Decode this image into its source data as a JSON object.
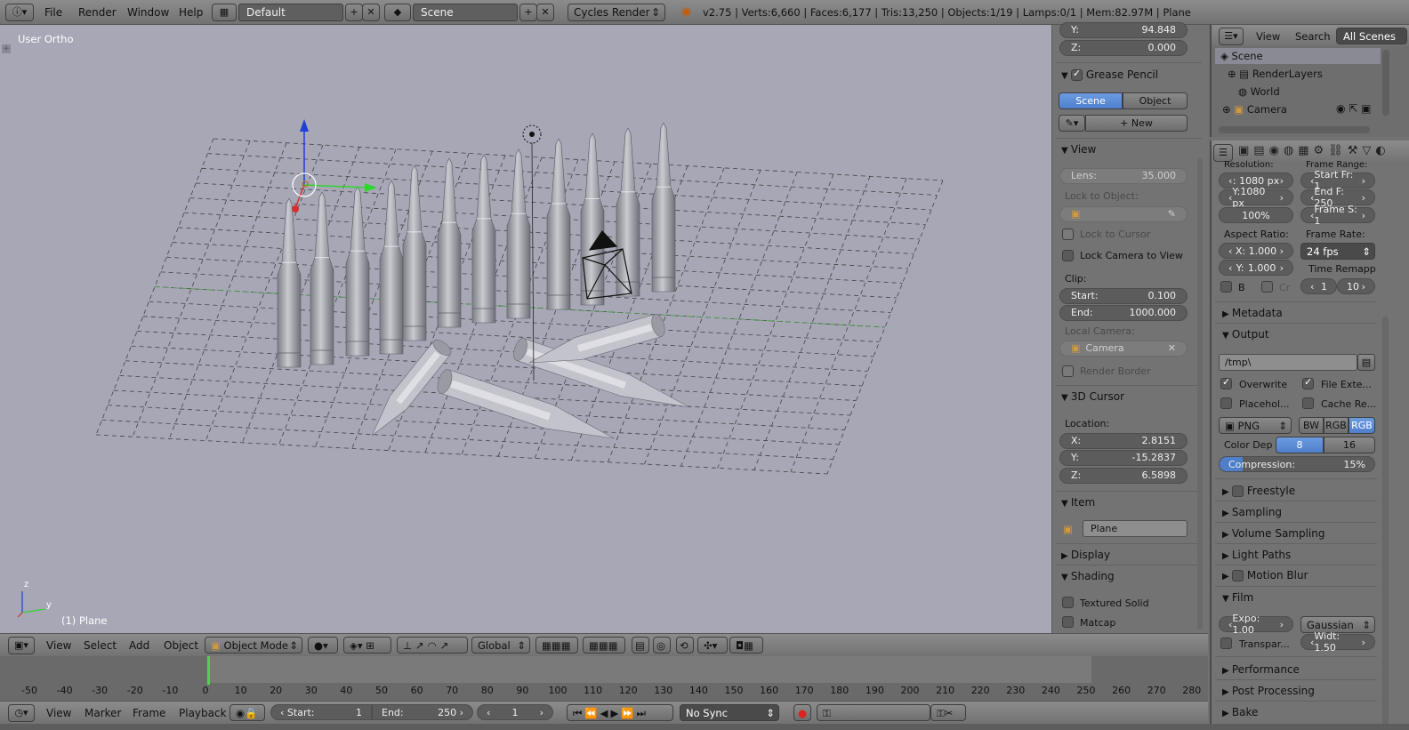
{
  "topbar": {
    "menus": [
      "File",
      "Render",
      "Window",
      "Help"
    ],
    "layout": "Default",
    "scene": "Scene",
    "engine": "Cycles Render",
    "stats": "v2.75 | Verts:6,660 | Faces:6,177 | Tris:13,250 | Objects:1/19 | Lamps:0/1 | Mem:82.97M | Plane"
  },
  "viewport": {
    "view_name": "User Ortho",
    "object_label": "(1) Plane",
    "axis_labels": [
      "z",
      "y"
    ]
  },
  "npanel": {
    "top_y": {
      "label": "Y:",
      "value": "94.848"
    },
    "top_z": {
      "label": "Z:",
      "value": "0.000"
    },
    "grease_pencil": {
      "title": "Grease Pencil",
      "scene_tab": "Scene",
      "object_tab": "Object",
      "new_label": "New"
    },
    "view": {
      "title": "View",
      "lens_label": "Lens:",
      "lens_value": "35.000",
      "lock_to_object": "Lock to Object:",
      "lock_to_cursor": "Lock to Cursor",
      "lock_camera": "Lock Camera to View",
      "clip": "Clip:",
      "clip_start_label": "Start:",
      "clip_start": "0.100",
      "clip_end_label": "End:",
      "clip_end": "1000.000",
      "local_camera": "Local Camera:",
      "camera_name": "Camera",
      "render_border": "Render Border"
    },
    "cursor": {
      "title": "3D Cursor",
      "location": "Location:",
      "x_label": "X:",
      "x": "2.8151",
      "y_label": "Y:",
      "y": "-15.2837",
      "z_label": "Z:",
      "z": "6.5898"
    },
    "item": {
      "title": "Item",
      "name": "Plane"
    },
    "display": {
      "title": "Display"
    },
    "shading": {
      "title": "Shading",
      "textured_solid": "Textured Solid",
      "matcap": "Matcap"
    }
  },
  "outliner": {
    "menu_view": "View",
    "menu_search": "Search",
    "all_scenes": "All Scenes",
    "items": [
      "Scene",
      "RenderLayers",
      "World",
      "Camera"
    ]
  },
  "props": {
    "resolution_label": "Resolution:",
    "frame_range_label": "Frame Range:",
    "res_x": ": 1080 px",
    "res_y": "Y:1080 px",
    "res_pct": "100%",
    "start_fr": "Start Fr: 1",
    "end_fr": "End F: 250",
    "frame_s": "Frame S: 1",
    "aspect_label": "Aspect Ratio:",
    "aspect_x_label": "X:",
    "aspect_x": "1.000",
    "aspect_y_label": "Y:",
    "aspect_y": "1.000",
    "frame_rate_label": "Frame Rate:",
    "frame_rate": "24 fps",
    "time_remap_label": "Time Remapp",
    "remap_old": "1",
    "remap_new": "10",
    "b_label": "B",
    "cr_label": "Cr",
    "metadata": "Metadata",
    "output": "Output",
    "output_path": "/tmp\\",
    "overwrite": "Overwrite",
    "file_ext": "File Exte...",
    "placeholders": "Placehol...",
    "cache_result": "Cache Re...",
    "format": "PNG",
    "bw": "BW",
    "rgb": "RGB",
    "rgba": "RGB",
    "color_depth": "Color Dep",
    "depth_8": "8",
    "depth_16": "16",
    "compression_label": "Compression:",
    "compression": "15%",
    "compression_fraction": 0.15,
    "freestyle": "Freestyle",
    "sampling": "Sampling",
    "volume_sampling": "Volume Sampling",
    "light_paths": "Light Paths",
    "motion_blur": "Motion Blur",
    "film": "Film",
    "exposure": "Expo: 1.00",
    "filter": "Gaussian",
    "transparent": "Transpar...",
    "width": "Widt: 1.50",
    "performance": "Performance",
    "post_processing": "Post Processing",
    "bake": "Bake"
  },
  "view3d_header": {
    "menus": [
      "View",
      "Select",
      "Add",
      "Object"
    ],
    "mode": "Object Mode",
    "orientation": "Global"
  },
  "timeline": {
    "ticks": [
      "-50",
      "-40",
      "-30",
      "-20",
      "-10",
      "0",
      "10",
      "20",
      "30",
      "40",
      "50",
      "60",
      "70",
      "80",
      "90",
      "100",
      "110",
      "120",
      "130",
      "140",
      "150",
      "160",
      "170",
      "180",
      "190",
      "200",
      "210",
      "220",
      "230",
      "240",
      "250",
      "260",
      "270",
      "280"
    ],
    "menus": [
      "View",
      "Marker",
      "Frame",
      "Playback"
    ],
    "start_label": "Start:",
    "start": "1",
    "end_label": "End:",
    "end": "250",
    "current": "1",
    "sync": "No Sync"
  },
  "colors": {
    "accent": "#5680c2",
    "viewport": "#a7a7b6",
    "panel": "#737373"
  }
}
